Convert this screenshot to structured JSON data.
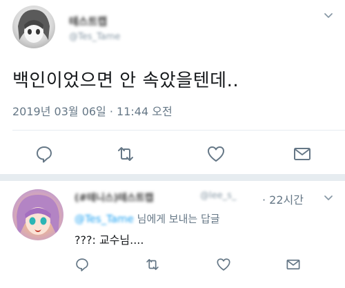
{
  "tweet": {
    "display_name": "테스트캡",
    "handle": "@Tes_Tame",
    "text": "백인이었으면 안 속았을텐데..",
    "date": "2019년 03월 06일 · 11:44 오전"
  },
  "reply": {
    "display_name": "(#테니스)테스트캡",
    "handle": "@lee_s_",
    "time": "· 22시간",
    "replying_to_handle": "@Tes_Tame",
    "replying_to_suffix": " 님에게 보내는 답글",
    "text": "???: 교수님...."
  },
  "icons": [
    "reply-icon",
    "retweet-icon",
    "like-icon",
    "message-icon",
    "chevron-down-icon"
  ],
  "colors": {
    "icon": "#657786",
    "link": "#1da1f2",
    "divider": "#e6ecf0"
  }
}
